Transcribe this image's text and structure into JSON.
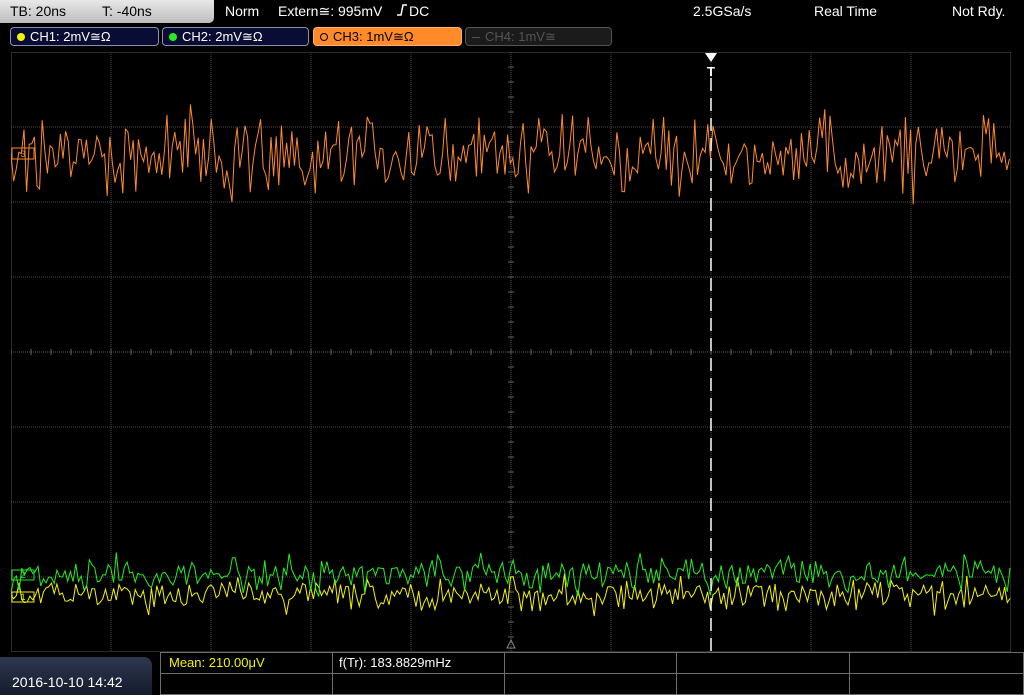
{
  "header": {
    "timebase": "TB: 20ns",
    "trigger_time": "T: -40ns",
    "acq_mode": "Norm",
    "trigger_source": "Extern≅: 995mV",
    "trigger_coupling": "DC",
    "sample_rate": "2.5GSa/s",
    "acq_type": "Real Time",
    "state": "Not Rdy."
  },
  "channels": [
    {
      "label": "CH1: 2mV≅Ω",
      "color": "#f4f400",
      "state": "on"
    },
    {
      "label": "CH2: 2mV≅Ω",
      "color": "#22ee22",
      "state": "on"
    },
    {
      "label": "CH3: 1mV≅Ω",
      "color": "#ff8a2a",
      "state": "selected"
    },
    {
      "label": "CH4: 1mV≅",
      "color": "#666666",
      "state": "off"
    }
  ],
  "markers": {
    "trigger_marker_label": "T",
    "ch3_level": "3",
    "ch2_level": "2",
    "ch1_level": "1"
  },
  "measurements": {
    "mean": "Mean: 210.00μV",
    "frequency": "f(Tr): 183.8829mHz"
  },
  "datetime": "2016-10-10 14:42",
  "colors": {
    "grid": "#4a4a4a",
    "background": "#000000",
    "ch1": "#f4f400",
    "ch2": "#22ee22",
    "ch3": "#ff8a2a"
  }
}
